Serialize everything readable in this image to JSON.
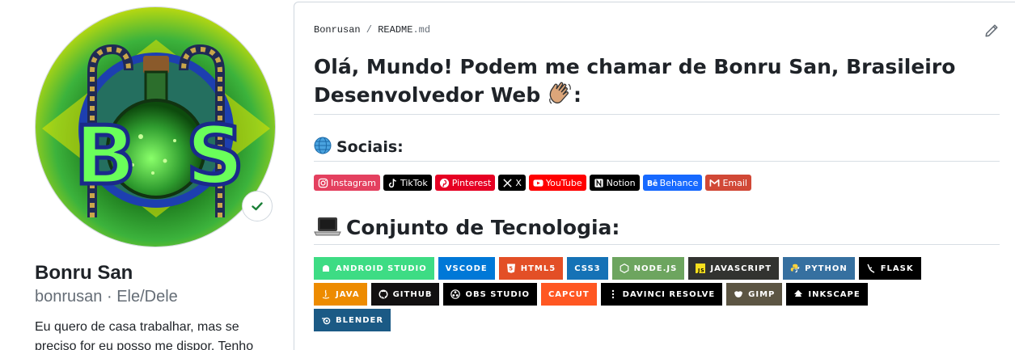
{
  "profile": {
    "avatar_letters": "BoS",
    "full_name": "Bonru San",
    "username": "bonrusan",
    "separator": " · ",
    "pronouns": "Ele/Dele",
    "bio": "Eu quero de casa trabalhar, mas se preciso for eu posso me dispor. Tenho"
  },
  "readme": {
    "repo": "Bonrusan",
    "path_sep": " / ",
    "file": "README",
    "ext": ".md",
    "title": "Olá, Mundo! Podem me chamar de Bonru San, Brasileiro Desenvolvedor Web",
    "title_suffix": ":",
    "sociais_heading": "Sociais:",
    "tech_heading": "Conjunto de Tecnologia:",
    "socials": [
      {
        "label": "Instagram",
        "color": "#E4405F",
        "icon": "instagram-icon"
      },
      {
        "label": "TikTok",
        "color": "#000000",
        "icon": "tiktok-icon"
      },
      {
        "label": "Pinterest",
        "color": "#E60023",
        "icon": "pinterest-icon"
      },
      {
        "label": "X",
        "color": "#000000",
        "icon": "x-icon"
      },
      {
        "label": "YouTube",
        "color": "#FF0000",
        "icon": "youtube-icon"
      },
      {
        "label": "Notion",
        "color": "#000000",
        "icon": "notion-icon"
      },
      {
        "label": "Behance",
        "color": "#1769FF",
        "icon": "behance-icon"
      },
      {
        "label": "Email",
        "color": "#D14836",
        "icon": "gmail-icon"
      }
    ],
    "tech": [
      {
        "label": "ANDROID STUDIO",
        "color": "#3DDC84",
        "icon": "android-studio-icon"
      },
      {
        "label": "VSCODE",
        "color": "#0078D7",
        "icon": ""
      },
      {
        "label": "HTML5",
        "color": "#E34F26",
        "icon": "html5-icon"
      },
      {
        "label": "CSS3",
        "color": "#1572B6",
        "icon": ""
      },
      {
        "label": "NODE.JS",
        "color": "#6DA55F",
        "icon": "nodejs-icon"
      },
      {
        "label": "JAVASCRIPT",
        "color": "#323330",
        "icon": "javascript-icon"
      },
      {
        "label": "PYTHON",
        "color": "#3670A0",
        "icon": "python-icon"
      },
      {
        "label": "FLASK",
        "color": "#000000",
        "icon": "flask-icon"
      },
      {
        "label": "JAVA",
        "color": "#ED8B00",
        "icon": "java-icon"
      },
      {
        "label": "GITHUB",
        "color": "#121011",
        "icon": "github-icon"
      },
      {
        "label": "OBS STUDIO",
        "color": "#000000",
        "icon": "obs-icon"
      },
      {
        "label": "CAPCUT",
        "color": "#FF5722",
        "icon": ""
      },
      {
        "label": "DAVINCI RESOLVE",
        "color": "#000000",
        "icon": "davinci-icon"
      },
      {
        "label": "GIMP",
        "color": "#5C5543",
        "icon": "gimp-icon"
      },
      {
        "label": "INKSCAPE",
        "color": "#000000",
        "icon": "inkscape-icon"
      },
      {
        "label": "BLENDER",
        "color": "#1B5A85",
        "icon": "blender-icon"
      }
    ]
  }
}
